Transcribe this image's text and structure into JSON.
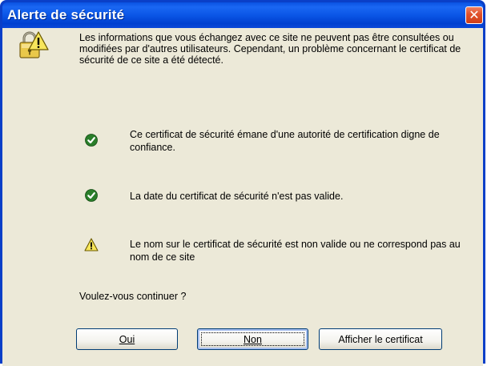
{
  "window": {
    "title": "Alerte de sécurité"
  },
  "intro": {
    "text": "Les informations que vous échangez avec ce site ne peuvent pas être consultées ou modifiées par d'autres utilisateurs. Cependant, un problème concernant le certificat de sécurité de ce site a été détecté."
  },
  "checks": [
    {
      "status": "ok",
      "icon": "check-icon",
      "text": "Ce certificat de sécurité émane d'une autorité de certification digne de confiance."
    },
    {
      "status": "ok",
      "icon": "check-icon",
      "text": "La date du certificat de sécurité n'est pas valide."
    },
    {
      "status": "warning",
      "icon": "warning-icon",
      "text": "Le nom sur le certificat de sécurité est non valide ou ne correspond pas au nom de ce site"
    }
  ],
  "question": "Voulez-vous continuer ?",
  "buttons": {
    "yes": "Oui",
    "no": "Non",
    "view_cert": "Afficher le certificat"
  },
  "colors": {
    "title_bar": "#0a52e2",
    "client_bg": "#ece9d8",
    "ok_green": "#2a7e2a",
    "warn_yellow": "#f7e65b",
    "close_red": "#e0502a"
  }
}
